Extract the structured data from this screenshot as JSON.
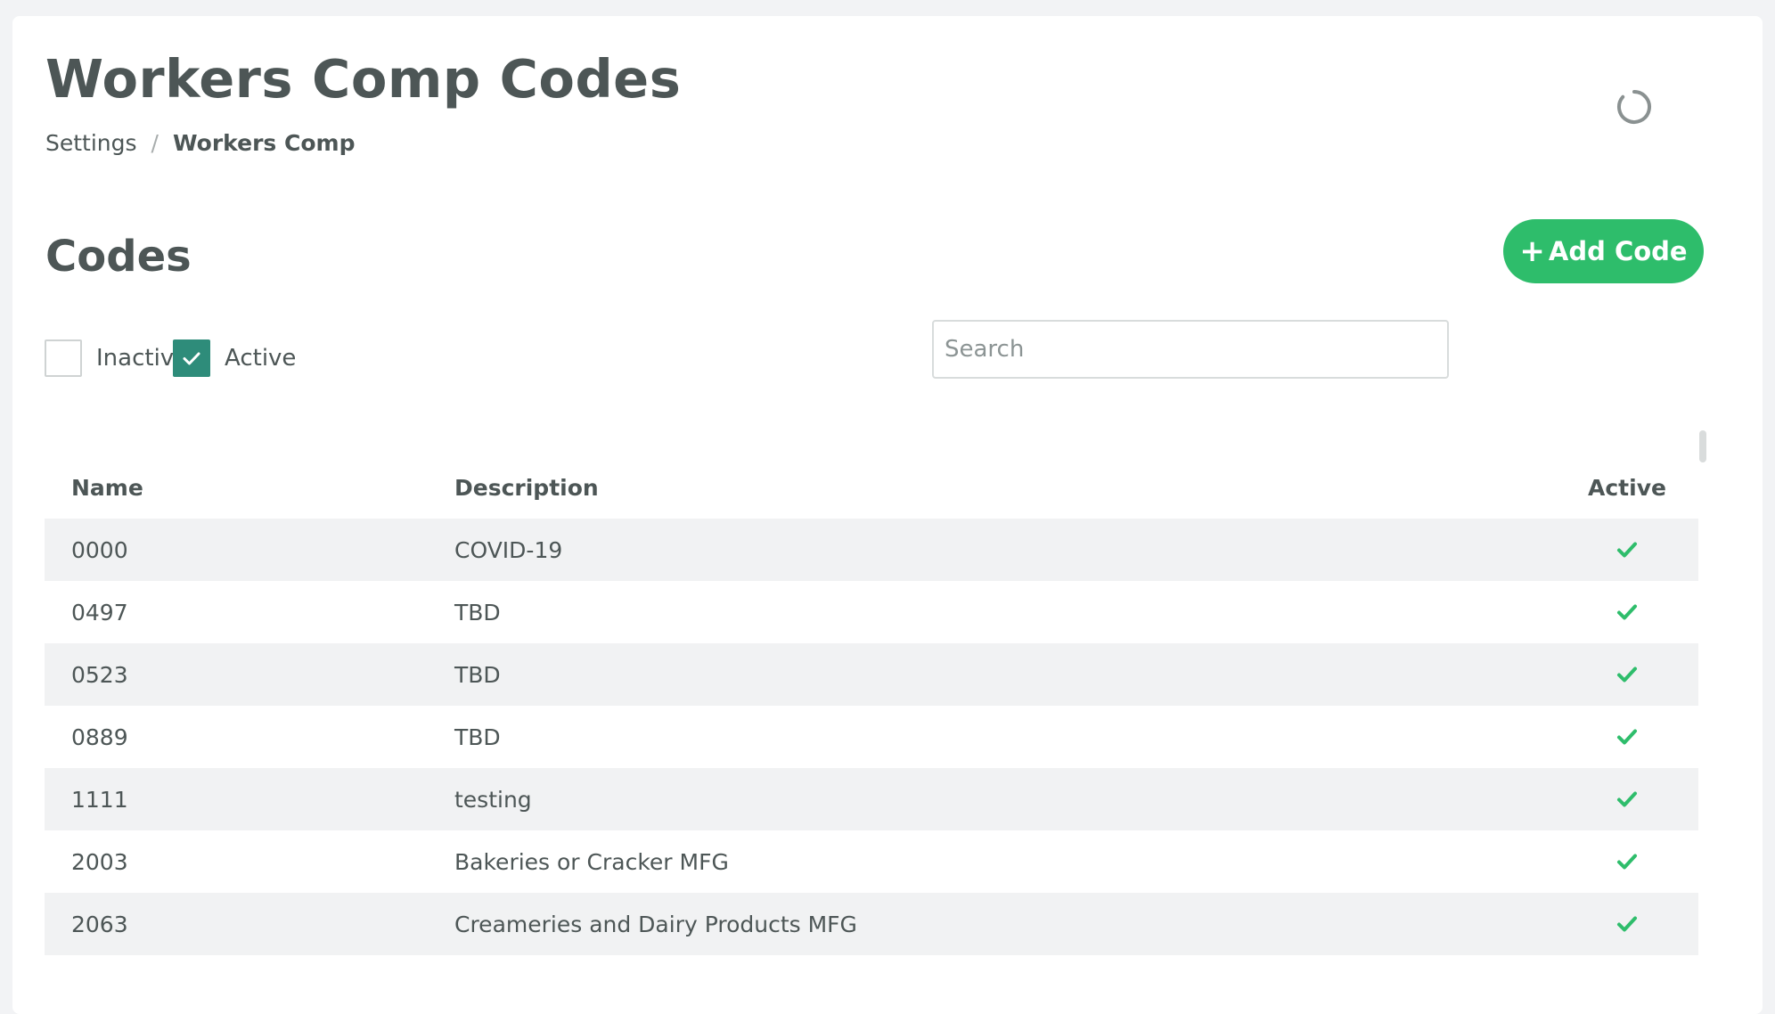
{
  "header": {
    "title": "Workers Comp Codes",
    "breadcrumb": {
      "parent": "Settings",
      "separator": "/",
      "current": "Workers Comp"
    }
  },
  "section": {
    "title": "Codes",
    "add_button_label": "Add Code"
  },
  "filters": {
    "inactive": {
      "label": "Inactive",
      "checked": false
    },
    "active": {
      "label": "Active",
      "checked": true
    }
  },
  "search": {
    "placeholder": "Search",
    "value": ""
  },
  "table": {
    "columns": [
      "Name",
      "Description",
      "Active"
    ],
    "rows": [
      {
        "name": "0000",
        "description": "COVID-19",
        "active": true
      },
      {
        "name": "0497",
        "description": "TBD",
        "active": true
      },
      {
        "name": "0523",
        "description": "TBD",
        "active": true
      },
      {
        "name": "0889",
        "description": "TBD",
        "active": true
      },
      {
        "name": "1111",
        "description": "testing",
        "active": true
      },
      {
        "name": "2003",
        "description": "Bakeries or Cracker MFG",
        "active": true
      },
      {
        "name": "2063",
        "description": "Creameries and Dairy Products MFG",
        "active": true
      }
    ]
  },
  "icons": {
    "spinner": "loading-spinner-icon",
    "plus": "plus-icon",
    "check": "check-icon"
  },
  "colors": {
    "accent_green": "#2ebd6b",
    "checkbox_teal": "#2e8c7a",
    "text": "#4d5656",
    "row_stripe": "#f1f2f3"
  }
}
